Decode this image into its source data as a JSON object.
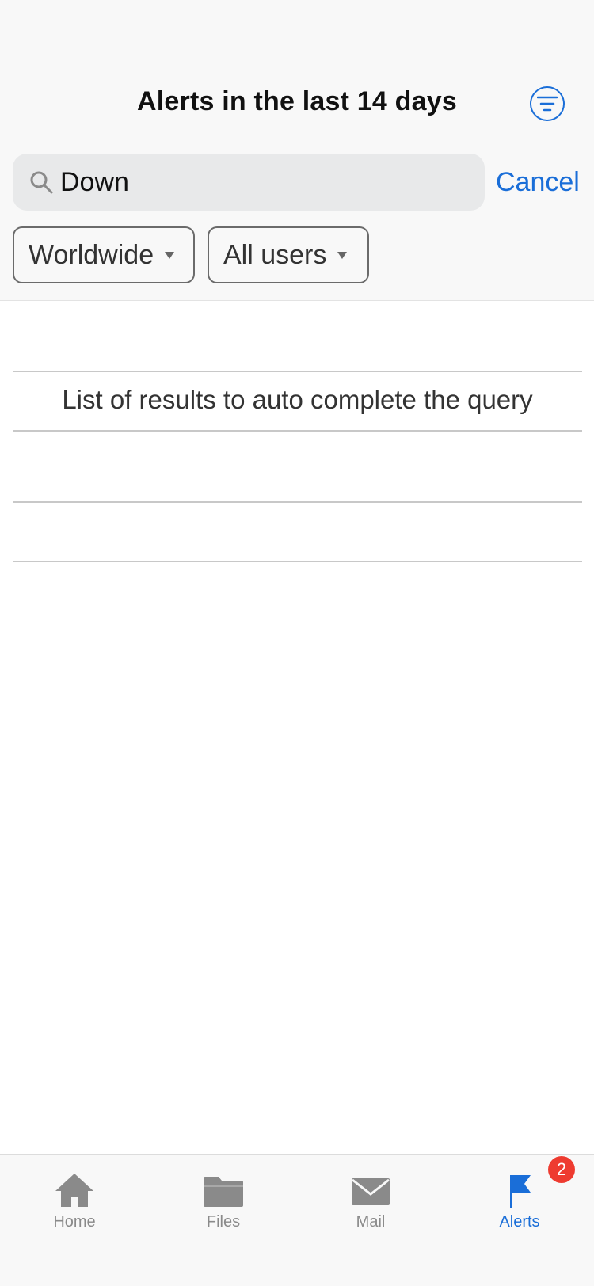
{
  "header": {
    "title": "Alerts in the last 14 days",
    "filter_icon": "filter-lines-icon"
  },
  "search": {
    "icon": "search-icon",
    "value": "Down",
    "cancel_label": "Cancel"
  },
  "filters": {
    "region": {
      "label": "Worldwide",
      "icon": "caret-down-icon"
    },
    "users": {
      "label": "All users",
      "icon": "caret-down-icon"
    }
  },
  "results": {
    "rows": [
      "",
      "List of results to auto complete the query",
      "",
      ""
    ]
  },
  "tabbar": {
    "tabs": [
      {
        "label": "Home",
        "icon": "home-icon",
        "active": false
      },
      {
        "label": "Files",
        "icon": "folder-icon",
        "active": false
      },
      {
        "label": "Mail",
        "icon": "mail-icon",
        "active": false
      },
      {
        "label": "Alerts",
        "icon": "flag-icon",
        "active": true
      }
    ],
    "alerts_badge": "2"
  },
  "colors": {
    "accent": "#1a6ed8",
    "badge": "#ee3b30",
    "inactive": "#8a8a8a",
    "search_bg": "#e8e9ea"
  }
}
